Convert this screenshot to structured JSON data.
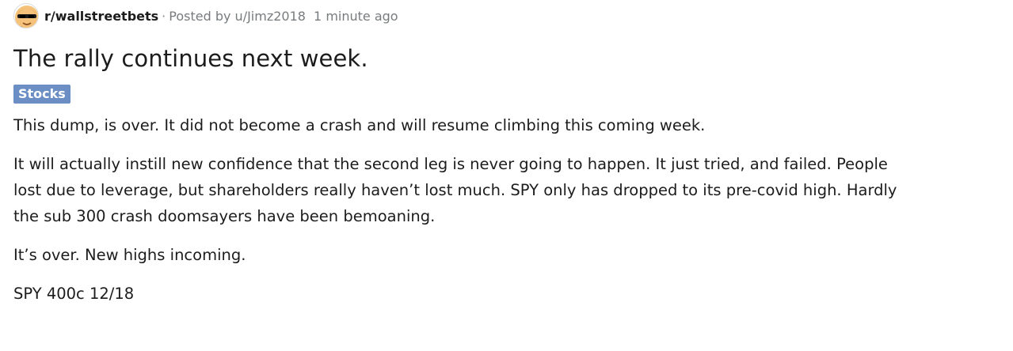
{
  "post": {
    "subreddit": "r/wallstreetbets",
    "separator": "·",
    "posted_by_prefix": "Posted by",
    "author": "u/Jimz2018",
    "time_ago": "1 minute ago",
    "title": "The rally continues next week.",
    "flair": "Stocks",
    "flair_color": "#6b8fc4",
    "paragraphs": [
      "This dump, is over. It did not become a crash and will resume climbing this coming week.",
      "It will actually instill new confidence that the second leg is never going to happen. It just tried, and failed. People lost due to leverage, but shareholders really haven’t lost much. SPY only has dropped to its pre-covid high. Hardly the sub 300 crash doomsayers have been bemoaning.",
      "It’s over. New highs incoming.",
      "SPY 400c 12/18"
    ]
  },
  "icons": {
    "avatar": "wallstreetbets-avatar-icon"
  },
  "colors": {
    "text": "#1c1c1c",
    "meta_text": "#787c7e"
  }
}
